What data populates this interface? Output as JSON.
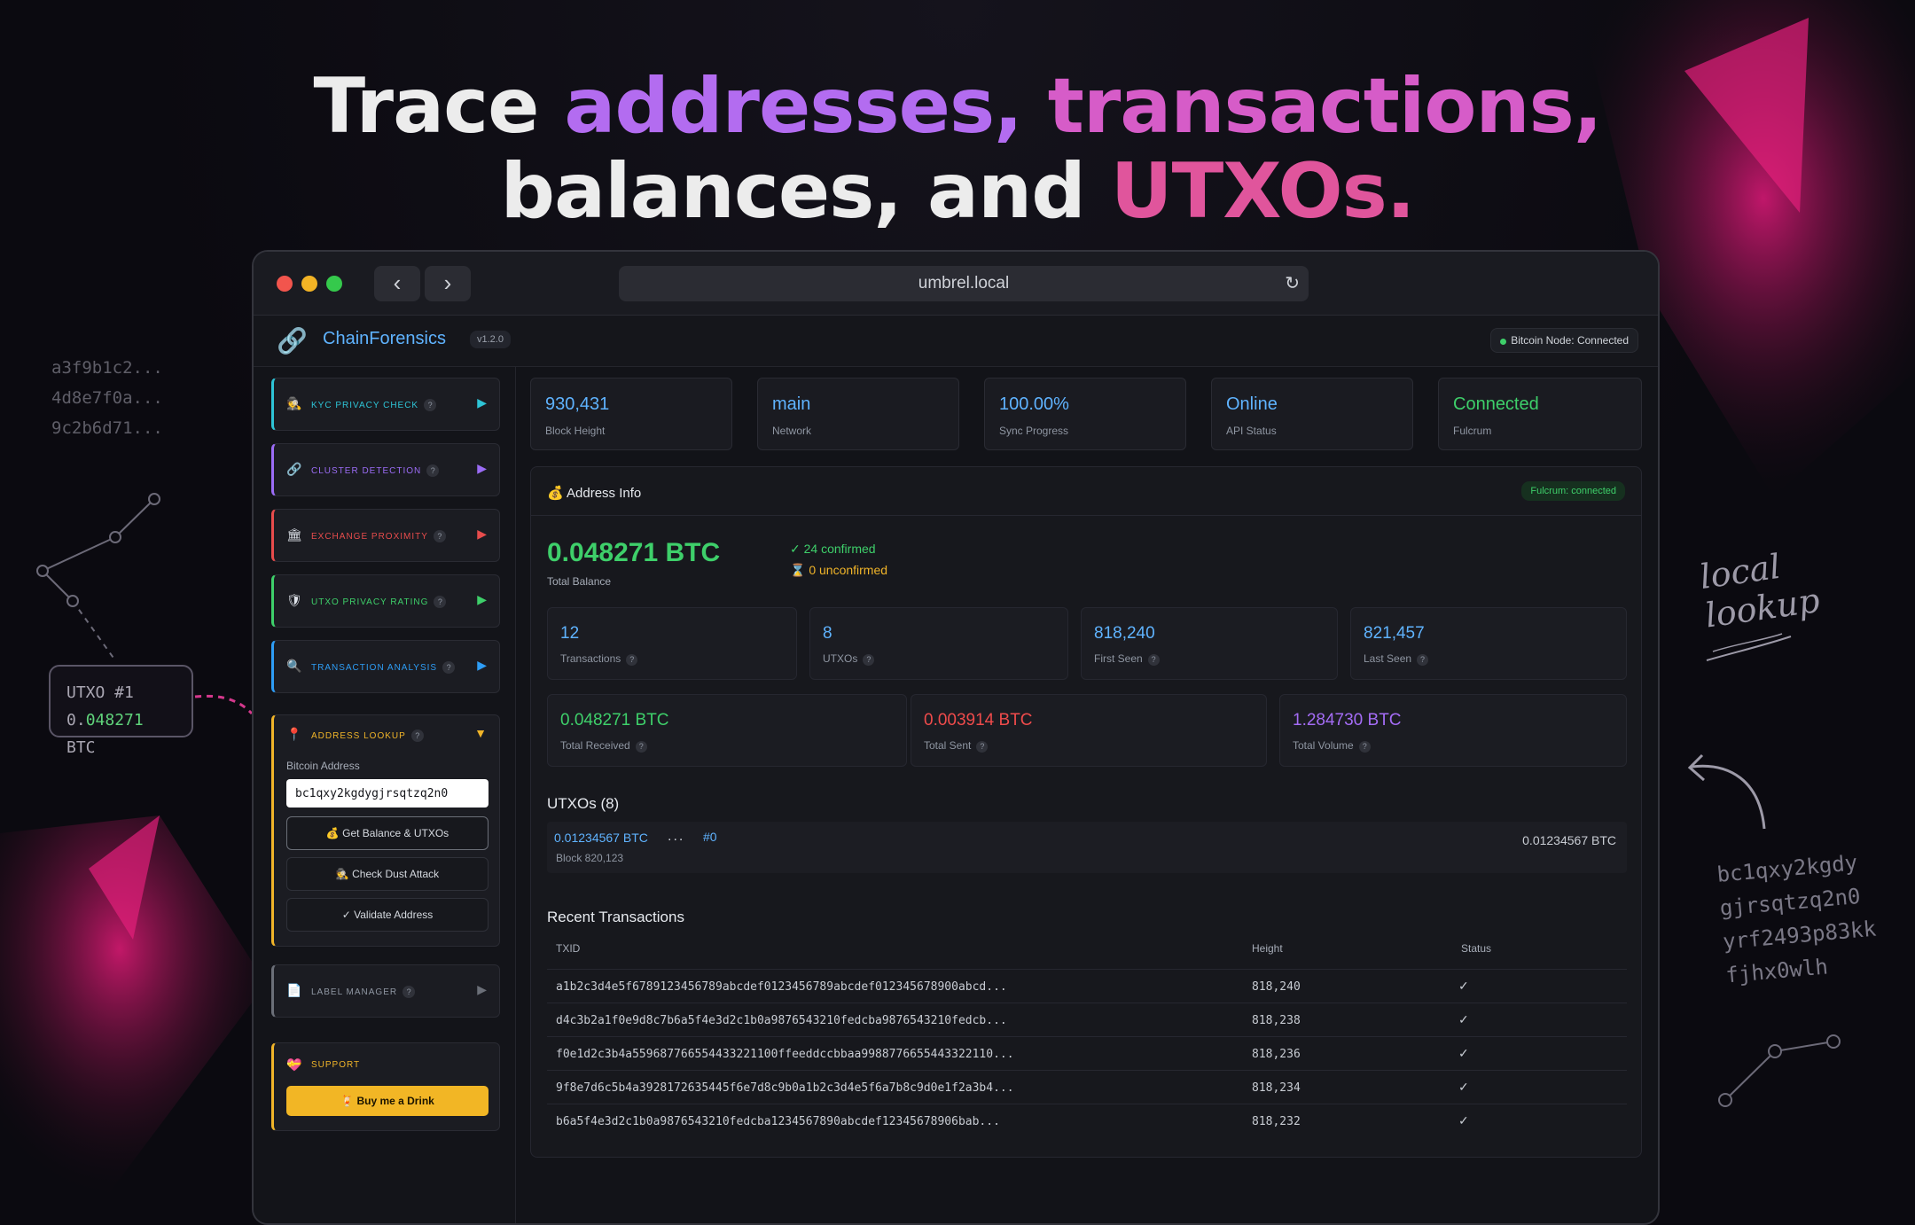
{
  "headline": {
    "line1_a": "Trace ",
    "line1_b": "addresses, ",
    "line1_c": "transactions,",
    "line2_a": "balances, and ",
    "line2_b": "UTXOs."
  },
  "decor": {
    "hashes": [
      "a3f9b1c2...",
      "4d8e7f0a...",
      "9c2b6d71..."
    ],
    "utxo_card": {
      "label": "UTXO #1",
      "amount_prefix": "0.",
      "amount_digits": "048271",
      "unit": " BTC"
    },
    "handwritten": {
      "line1": "local",
      "line2": "lookup"
    },
    "right_hex": [
      "bc1qxy2kgdy",
      "gjrsqtzq2n0",
      "yrf2493p83kk",
      "fjhx0wlh"
    ]
  },
  "browser": {
    "url": "umbrel.local",
    "back_icon": "chevron-left-icon",
    "forward_icon": "chevron-right-icon"
  },
  "app": {
    "name": "ChainForensics",
    "version": "v1.2.0",
    "node_status": "Bitcoin Node: Connected"
  },
  "sidebar": {
    "items": [
      {
        "label": "KYC Privacy Check",
        "icon": "detective-icon",
        "color": "#2ec4d6"
      },
      {
        "label": "Cluster Detection",
        "icon": "link-icon",
        "color": "#9b6cf5"
      },
      {
        "label": "Exchange Proximity",
        "icon": "bank-icon",
        "color": "#e74c4c"
      },
      {
        "label": "UTXO Privacy Rating",
        "icon": "shield-icon",
        "color": "#3ecf6a"
      },
      {
        "label": "Transaction Analysis",
        "icon": "magnifier-icon",
        "color": "#2e9df5"
      },
      {
        "label": "Label Manager",
        "icon": "document-icon",
        "color": "#6b6f78"
      }
    ],
    "address_lookup": {
      "title": "Address Lookup",
      "field_label": "Bitcoin Address",
      "address_value": "bc1qxy2kgdygjrsqtzq2n0",
      "btn_balance": "Get Balance & UTXOs",
      "btn_dust": "Check Dust Attack",
      "btn_validate": "Validate Address"
    },
    "support": {
      "title": "Support",
      "button": "Buy me a Drink"
    }
  },
  "stats": [
    {
      "value": "930,431",
      "label": "Block Height",
      "color": "#5fb3ff"
    },
    {
      "value": "main",
      "label": "Network",
      "color": "#5fb3ff"
    },
    {
      "value": "100.00%",
      "label": "Sync Progress",
      "color": "#5fb3ff"
    },
    {
      "value": "Online",
      "label": "API Status",
      "color": "#5fb3ff"
    },
    {
      "value": "Connected",
      "label": "Fulcrum",
      "color": "#3ecf6a"
    }
  ],
  "address_info": {
    "title": "Address Info",
    "fulcrum_tag": "Fulcrum: connected",
    "balance": "0.048271  BTC",
    "balance_label": "Total Balance",
    "confirmed": "✓ 24 confirmed",
    "unconfirmed": "⌛ 0 unconfirmed",
    "metrics": [
      {
        "value": "12",
        "label": "Transactions"
      },
      {
        "value": "8",
        "label": "UTXOs"
      },
      {
        "value": "818,240",
        "label": "First Seen"
      },
      {
        "value": "821,457",
        "label": "Last Seen"
      }
    ],
    "totals": [
      {
        "value": "0.048271 BTC",
        "label": "Total Received",
        "color": "#3ecf6a"
      },
      {
        "value": "0.003914 BTC",
        "label": "Total Sent",
        "color": "#ef4b4b"
      },
      {
        "value": "1.284730 BTC",
        "label": "Total Volume",
        "color": "#a46cf5"
      }
    ],
    "utxos_title": "UTXOs (8)",
    "utxo": {
      "amount": "0.01234567 BTC",
      "dots": "...",
      "index": "#0",
      "block": "Block 820,123",
      "value": "0.01234567 BTC"
    },
    "recent_title": "Recent Transactions",
    "table_headers": [
      "TXID",
      "Height",
      "Status"
    ],
    "transactions": [
      {
        "txid": "a1b2c3d4e5f6789123456789abcdef0123456789abcdef012345678900abcd...",
        "height": "818,240",
        "status": "✓"
      },
      {
        "txid": "d4c3b2a1f0e9d8c7b6a5f4e3d2c1b0a9876543210fedcba9876543210fedcb...",
        "height": "818,238",
        "status": "✓"
      },
      {
        "txid": "f0e1d2c3b4a5596877665544332211​00ffeeddccbbaa99887766554433221​10...",
        "height": "818,236",
        "status": "✓"
      },
      {
        "txid": "9f8e7d6c5b4a3928172635445f6e7d8c9b0a1b2c3d4e5f6a7b8c9d0e1f2a3b4...",
        "height": "818,234",
        "status": "✓"
      },
      {
        "txid": "b6a5f4e3d2c1b0a9876543210fedcba1234567890abcdef12345678906bab...",
        "height": "818,232",
        "status": "✓"
      }
    ]
  }
}
